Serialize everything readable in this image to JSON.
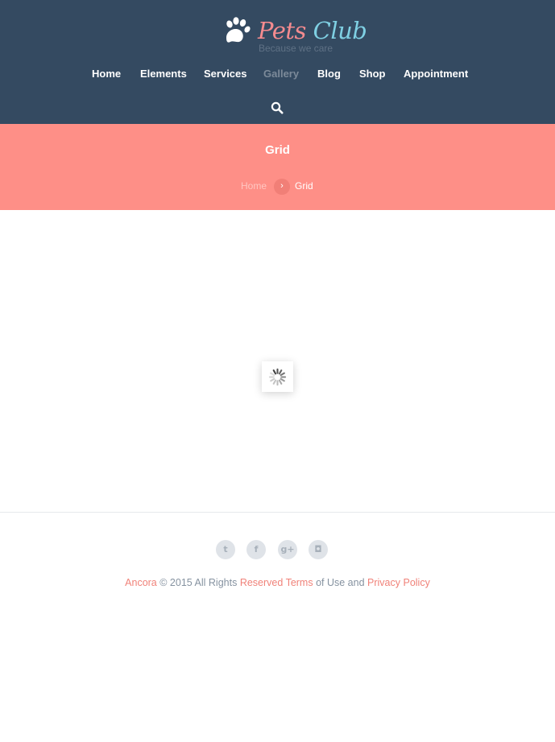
{
  "header": {
    "logo_part1": "Pets",
    "logo_part2": "Club",
    "tagline": "Because we care",
    "nav": [
      {
        "label": "Home"
      },
      {
        "label": "Elements"
      },
      {
        "label": "Services"
      },
      {
        "label": "Gallery",
        "active": true
      },
      {
        "label": "Blog"
      },
      {
        "label": "Shop"
      },
      {
        "label": "Appointment"
      }
    ],
    "search_icon": "search-icon"
  },
  "title_bar": {
    "title": "Grid",
    "breadcrumb": {
      "home": "Home",
      "separator": "›",
      "current": "Grid"
    }
  },
  "content": {
    "loader_icon": "spinner-icon"
  },
  "footer": {
    "social": [
      {
        "icon": "twitter-icon",
        "glyph": "t"
      },
      {
        "icon": "facebook-icon",
        "glyph": "f"
      },
      {
        "icon": "google-plus-icon",
        "glyph": "g+"
      },
      {
        "icon": "instagram-icon",
        "glyph": "◘"
      }
    ],
    "copyright": {
      "brand": "Ancora",
      "text1": "© 2015 All Rights",
      "reserved": "Reserved",
      "terms": "Terms",
      "text2": "of Use and",
      "privacy": "Privacy Policy"
    }
  },
  "colors": {
    "header_bg": "#344a61",
    "title_bar_bg": "#fe8f87",
    "accent": "#f08279",
    "logo_pink": "#f58b8f",
    "logo_blue": "#7fd0e3"
  }
}
